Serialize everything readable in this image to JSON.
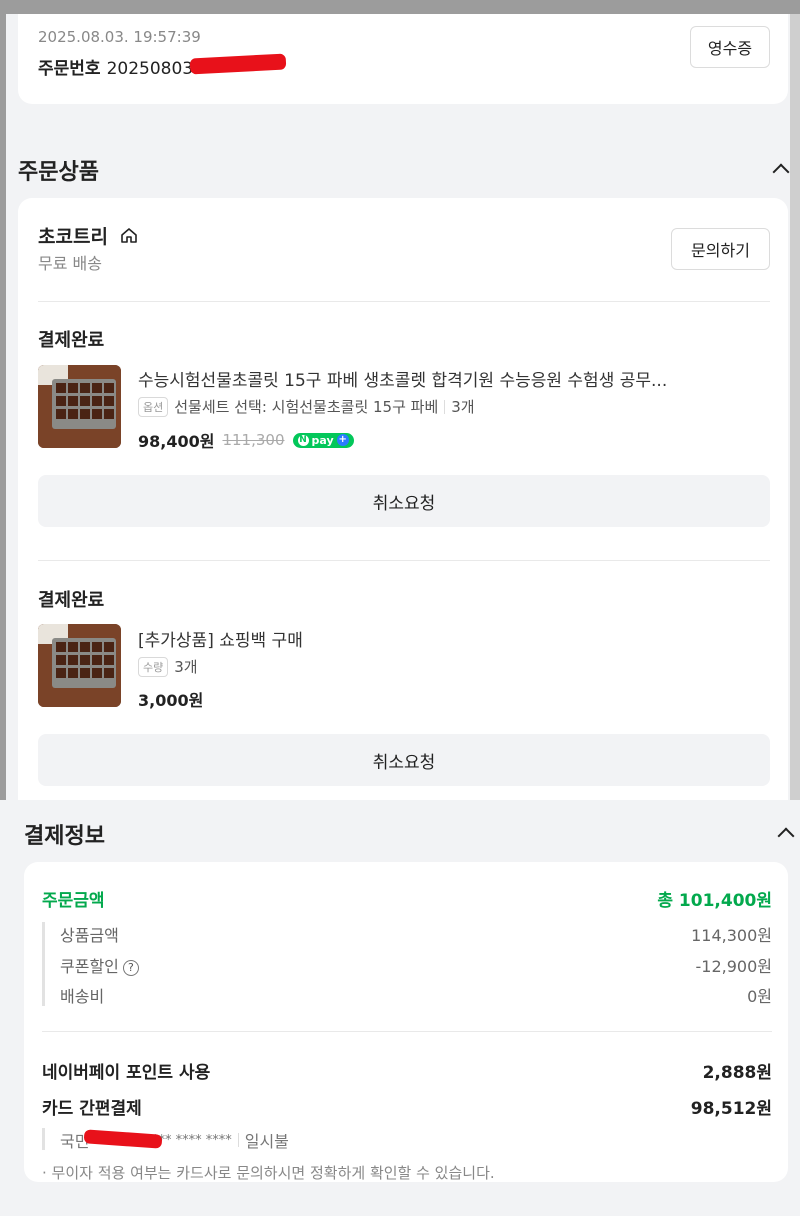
{
  "order": {
    "datetime": "2025.08.03. 19:57:39",
    "number_label": "주문번호",
    "number": "20250803",
    "receipt_button": "영수증"
  },
  "products_section": {
    "title": "주문상품",
    "store": {
      "name": "초코트리",
      "shipping": "무료 배송",
      "inquiry_button": "문의하기"
    },
    "items": [
      {
        "status": "결제완료",
        "name": "수능시험선물초콜릿 15구 파베 생초콜렛 합격기원 수능응원 수험생 공무...",
        "option_tag": "옵션",
        "option": "선물세트 선택: 시험선물초콜릿 15구 파베",
        "quantity": "3개",
        "price": "98,400원",
        "original_price": "111,300",
        "npay_label": "pay",
        "cancel_button": "취소요청"
      },
      {
        "status": "결제완료",
        "name": "[추가상품] 쇼핑백 구매",
        "option_tag": "수량",
        "quantity": "3개",
        "price": "3,000원",
        "cancel_button": "취소요청"
      }
    ]
  },
  "payment_section": {
    "title": "결제정보",
    "order_amount_label": "주문금액",
    "order_amount": "총 101,400원",
    "breakdown": [
      {
        "label": "상품금액",
        "value": "114,300원"
      },
      {
        "label": "쿠폰할인",
        "value": "-12,900원"
      },
      {
        "label": "배송비",
        "value": "0원"
      }
    ],
    "point_label": "네이버페이 포인트 사용",
    "point_value": "2,888원",
    "card_label": "카드 간편결제",
    "card_value": "98,512원",
    "card_bank": "국민",
    "card_number": "**** **** ****",
    "card_plan": "일시불",
    "note": "· 무이자 적용 여부는 카드사로 문의하시면 정확하게 확인할 수 있습니다."
  },
  "colors": {
    "accent_green": "#03a94d",
    "npay_green": "#03c75a",
    "redaction": "#e8111a",
    "background": "#f2f3f5"
  }
}
